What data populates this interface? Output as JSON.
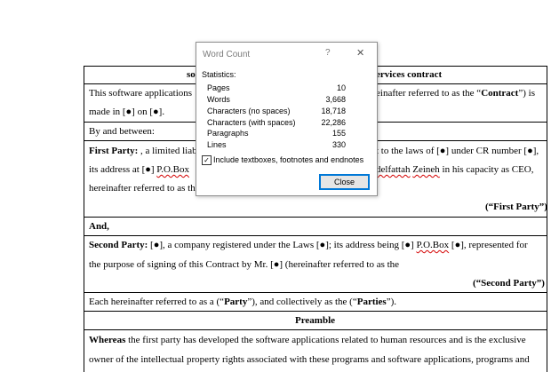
{
  "document": {
    "title_left": "so",
    "title_right": "ervices contract",
    "row1_left": "This software applications",
    "row1_right": "einafter referred to as the “",
    "row1_bold": "Contract",
    "row1_end": "”) is",
    "row1b": "made in [●] on [●].",
    "row2": "By and between:",
    "row3_bold": "First Party:",
    "row3_left": " ,  a limited liabi",
    "row3_right": "t to the laws of [●] under CR number [●],",
    "row3b_left": "its address at [●] ",
    "row3b_pobox": "P.O.Box",
    "row3b_right_sq": "delfattah",
    "row3b_right_mid": " ",
    "row3b_right_sq2": "Zeineh",
    "row3b_right_end": " in his capacity as CEO,",
    "row3c": "hereinafter referred to as th",
    "row3d": "(“First Party”)",
    "row4": "And,",
    "row5_bold": "Second Party:",
    "row5_text": " [●], a company registered under the Laws [●]; its address being [●] ",
    "row5_pobox": "P.O.Box",
    "row5_end": " [●], represented for",
    "row5b": "the purpose of signing of this Contract by Mr. [●]  (hereinafter referred to as the",
    "row5c": "(“Second Party”)",
    "row6_a": "Each hereinafter referred to as a (“",
    "row6_b": "Party",
    "row6_c": "”), and collectively as the (“",
    "row6_d": "Parties",
    "row6_e": "”).",
    "row7": "Preamble",
    "row8_bold": "Whereas",
    "row8_text": " the first party has developed the software applications related to human resources and is the exclusive",
    "row8b": "owner of the intellectual property rights associated with these programs and software applications, programs and"
  },
  "dialog": {
    "title": "Word Count",
    "help": "?",
    "close": "✕",
    "statistics_label": "Statistics:",
    "stats": [
      {
        "label": "Pages",
        "value": "10"
      },
      {
        "label": "Words",
        "value": "3,668"
      },
      {
        "label": "Characters (no spaces)",
        "value": "18,718"
      },
      {
        "label": "Characters (with spaces)",
        "value": "22,286"
      },
      {
        "label": "Paragraphs",
        "value": "155"
      },
      {
        "label": "Lines",
        "value": "330"
      }
    ],
    "checkbox_mark": "✓",
    "checkbox_label": "Include textboxes, footnotes and endnotes",
    "close_button": "Close"
  }
}
